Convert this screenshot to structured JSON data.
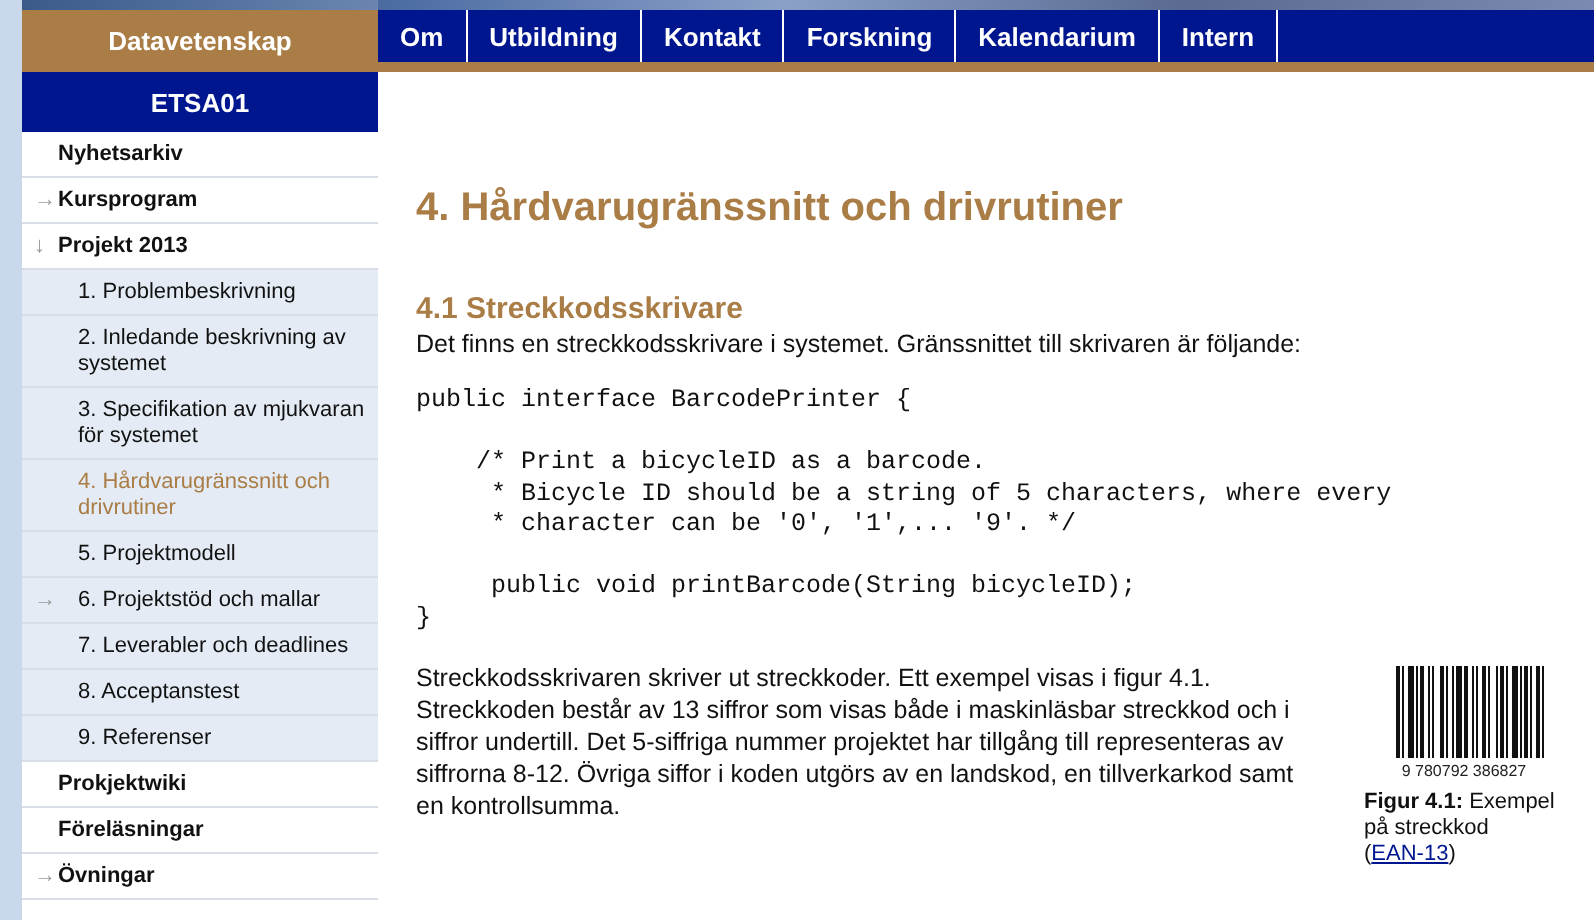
{
  "header": {
    "site_title": "Datavetenskap",
    "nav": [
      {
        "label": "Om"
      },
      {
        "label": "Utbildning"
      },
      {
        "label": "Kontakt"
      },
      {
        "label": "Forskning"
      },
      {
        "label": "Kalendarium"
      },
      {
        "label": "Intern"
      }
    ]
  },
  "sidebar": {
    "course": "ETSA01",
    "items": [
      {
        "label": "Nyhetsarkiv",
        "selected": false
      },
      {
        "label": "Kursprogram",
        "icon": "→",
        "selected": false
      },
      {
        "label": "Projekt 2013",
        "icon": "↓",
        "selected": false,
        "children": [
          {
            "label": "1. Problembeskrivning",
            "selected": false
          },
          {
            "label": "2. Inledande beskrivning av systemet",
            "selected": false
          },
          {
            "label": "3. Specifikation av mjukvaran för systemet",
            "selected": false
          },
          {
            "label": "4. Hårdvarugränssnitt och drivrutiner",
            "selected": true
          },
          {
            "label": "5. Projektmodell",
            "selected": false
          },
          {
            "label": "6. Projektstöd och mallar",
            "icon": "→",
            "selected": false
          },
          {
            "label": "7. Leverabler och deadlines",
            "selected": false
          },
          {
            "label": "8. Acceptanstest",
            "selected": false
          },
          {
            "label": "9. Referenser",
            "selected": false
          }
        ]
      },
      {
        "label": "Prokjektwiki",
        "selected": false
      },
      {
        "label": "Föreläsningar",
        "selected": false
      },
      {
        "label": "Övningar",
        "icon": "→",
        "selected": false
      }
    ]
  },
  "content": {
    "title": "4. Hårdvarugränssnitt och drivrutiner",
    "section_title": "4.1 Streckkodsskrivare",
    "intro": "Det finns en streckkodsskrivare i systemet. Gränssnittet till skrivaren är följande:",
    "code": "public interface BarcodePrinter {\n\n    /* Print a bicycleID as a barcode.\n     * Bicycle ID should be a string of 5 characters, where every\n     * character can be '0', '1',... '9'. */\n\n     public void printBarcode(String bicycleID);\n}",
    "body": "Streckkodsskrivaren skriver ut streckkoder. Ett exempel visas i figur 4.1. Streckkoden består av 13 siffror som visas både i maskinläsbar streckkod och i siffror undertill. Det 5-siffriga nummer projektet har tillgång till representeras av siffrorna 8-12. Övriga siffor i koden utgörs av en landskod, en tillverkarkod samt en kontrollsumma.",
    "figure": {
      "barcode_digits": "9 780792 386827",
      "caption_label": "Figur 4.1:",
      "caption_text": "Exempel på streckkod (",
      "caption_link": "EAN-13",
      "caption_end": ")"
    }
  }
}
